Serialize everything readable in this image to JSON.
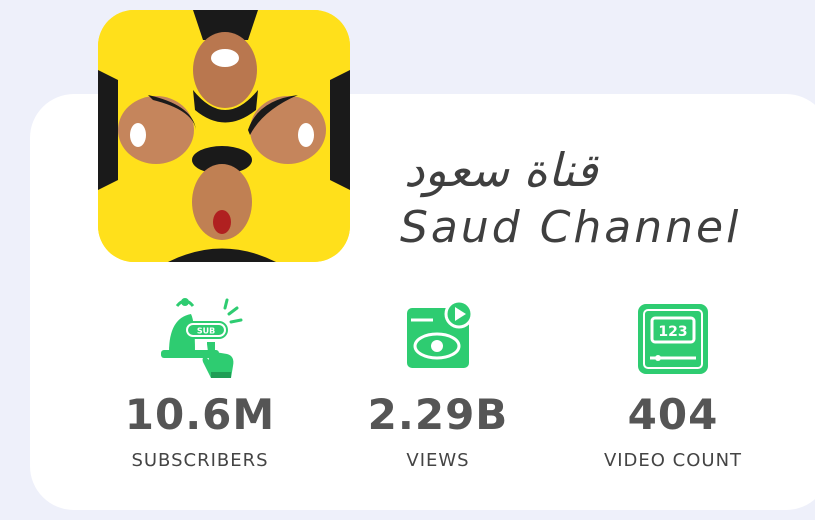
{
  "channel": {
    "name_ar": "قناة سعود",
    "name_en": "Saud Channel",
    "avatar_icon": "channel-avatar-icon"
  },
  "stats": [
    {
      "icon": "subscribe-bell-icon",
      "value": "10.6M",
      "label": "SUBSCRIBERS"
    },
    {
      "icon": "video-views-icon",
      "value": "2.29B",
      "label": "VIEWS"
    },
    {
      "icon": "video-count-icon",
      "value": "404",
      "label": "VIDEO COUNT"
    }
  ],
  "colors": {
    "background": "#eef0fa",
    "card": "#ffffff",
    "accent_green": "#2ecc71",
    "avatar_yellow": "#ffe01b",
    "text_dark": "#555555"
  }
}
